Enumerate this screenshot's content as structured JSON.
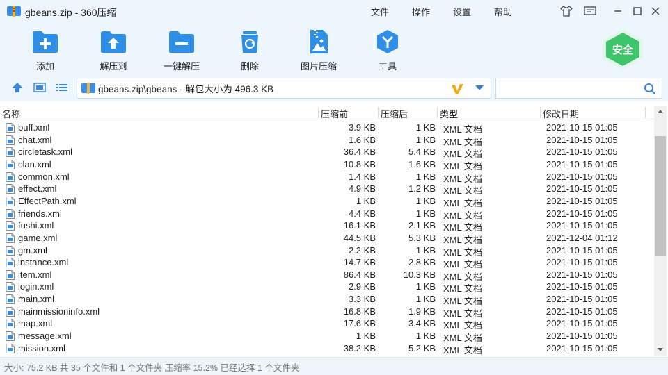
{
  "window": {
    "title": "gbeans.zip - 360压缩"
  },
  "menu": [
    "文件",
    "操作",
    "设置",
    "帮助"
  ],
  "toolbar": [
    {
      "label": "添加",
      "icon": "add-folder-icon"
    },
    {
      "label": "解压到",
      "icon": "extract-to-icon"
    },
    {
      "label": "一键解压",
      "icon": "one-click-extract-icon"
    },
    {
      "label": "删除",
      "icon": "delete-icon"
    },
    {
      "label": "图片压缩",
      "icon": "image-compress-icon"
    },
    {
      "label": "工具",
      "icon": "tools-icon"
    }
  ],
  "badge": {
    "label": "安全"
  },
  "nav": {
    "path": "gbeans.zip\\gbeans - 解包大小为 496.3 KB",
    "search_placeholder": ""
  },
  "columns": {
    "name": "名称",
    "size": "压缩前",
    "compressed": "压缩后",
    "type": "类型",
    "modified": "修改日期"
  },
  "files": [
    {
      "name": "buff.xml",
      "size": "3.9 KB",
      "compressed": "1 KB",
      "type": "XML 文档",
      "modified": "2021-10-15 01:05"
    },
    {
      "name": "chat.xml",
      "size": "1.6 KB",
      "compressed": "1 KB",
      "type": "XML 文档",
      "modified": "2021-10-15 01:05"
    },
    {
      "name": "circletask.xml",
      "size": "36.4 KB",
      "compressed": "5.4 KB",
      "type": "XML 文档",
      "modified": "2021-10-15 01:05"
    },
    {
      "name": "clan.xml",
      "size": "10.8 KB",
      "compressed": "1.6 KB",
      "type": "XML 文档",
      "modified": "2021-10-15 01:05"
    },
    {
      "name": "common.xml",
      "size": "1.4 KB",
      "compressed": "1 KB",
      "type": "XML 文档",
      "modified": "2021-10-15 01:05"
    },
    {
      "name": "effect.xml",
      "size": "4.9 KB",
      "compressed": "1.2 KB",
      "type": "XML 文档",
      "modified": "2021-10-15 01:05"
    },
    {
      "name": "EffectPath.xml",
      "size": "1 KB",
      "compressed": "1 KB",
      "type": "XML 文档",
      "modified": "2021-10-15 01:05"
    },
    {
      "name": "friends.xml",
      "size": "4.4 KB",
      "compressed": "1 KB",
      "type": "XML 文档",
      "modified": "2021-10-15 01:05"
    },
    {
      "name": "fushi.xml",
      "size": "16.1 KB",
      "compressed": "2.1 KB",
      "type": "XML 文档",
      "modified": "2021-10-15 01:05"
    },
    {
      "name": "game.xml",
      "size": "44.5 KB",
      "compressed": "5.3 KB",
      "type": "XML 文档",
      "modified": "2021-12-04 01:12"
    },
    {
      "name": "gm.xml",
      "size": "2.2 KB",
      "compressed": "1 KB",
      "type": "XML 文档",
      "modified": "2021-10-15 01:05"
    },
    {
      "name": "instance.xml",
      "size": "14.7 KB",
      "compressed": "2.8 KB",
      "type": "XML 文档",
      "modified": "2021-10-15 01:05"
    },
    {
      "name": "item.xml",
      "size": "86.4 KB",
      "compressed": "10.3 KB",
      "type": "XML 文档",
      "modified": "2021-10-15 01:05"
    },
    {
      "name": "login.xml",
      "size": "2.9 KB",
      "compressed": "1 KB",
      "type": "XML 文档",
      "modified": "2021-10-15 01:05"
    },
    {
      "name": "main.xml",
      "size": "3.3 KB",
      "compressed": "1 KB",
      "type": "XML 文档",
      "modified": "2021-10-15 01:05"
    },
    {
      "name": "mainmissioninfo.xml",
      "size": "16.8 KB",
      "compressed": "1.9 KB",
      "type": "XML 文档",
      "modified": "2021-10-15 01:05"
    },
    {
      "name": "map.xml",
      "size": "17.6 KB",
      "compressed": "3.4 KB",
      "type": "XML 文档",
      "modified": "2021-10-15 01:05"
    },
    {
      "name": "message.xml",
      "size": "1 KB",
      "compressed": "1 KB",
      "type": "XML 文档",
      "modified": "2021-10-15 01:05"
    },
    {
      "name": "mission.xml",
      "size": "38.2 KB",
      "compressed": "5.2 KB",
      "type": "XML 文档",
      "modified": "2021-10-15 01:05"
    }
  ],
  "status": "大小: 75.2 KB 共 35 个文件和 1 个文件夹 压缩率 15.2% 已经选择 1 个文件夹",
  "colors": {
    "accent": "#2f8fe6",
    "safe_green": "#3ec46a",
    "toolbar_bg": "#eef6fd"
  }
}
